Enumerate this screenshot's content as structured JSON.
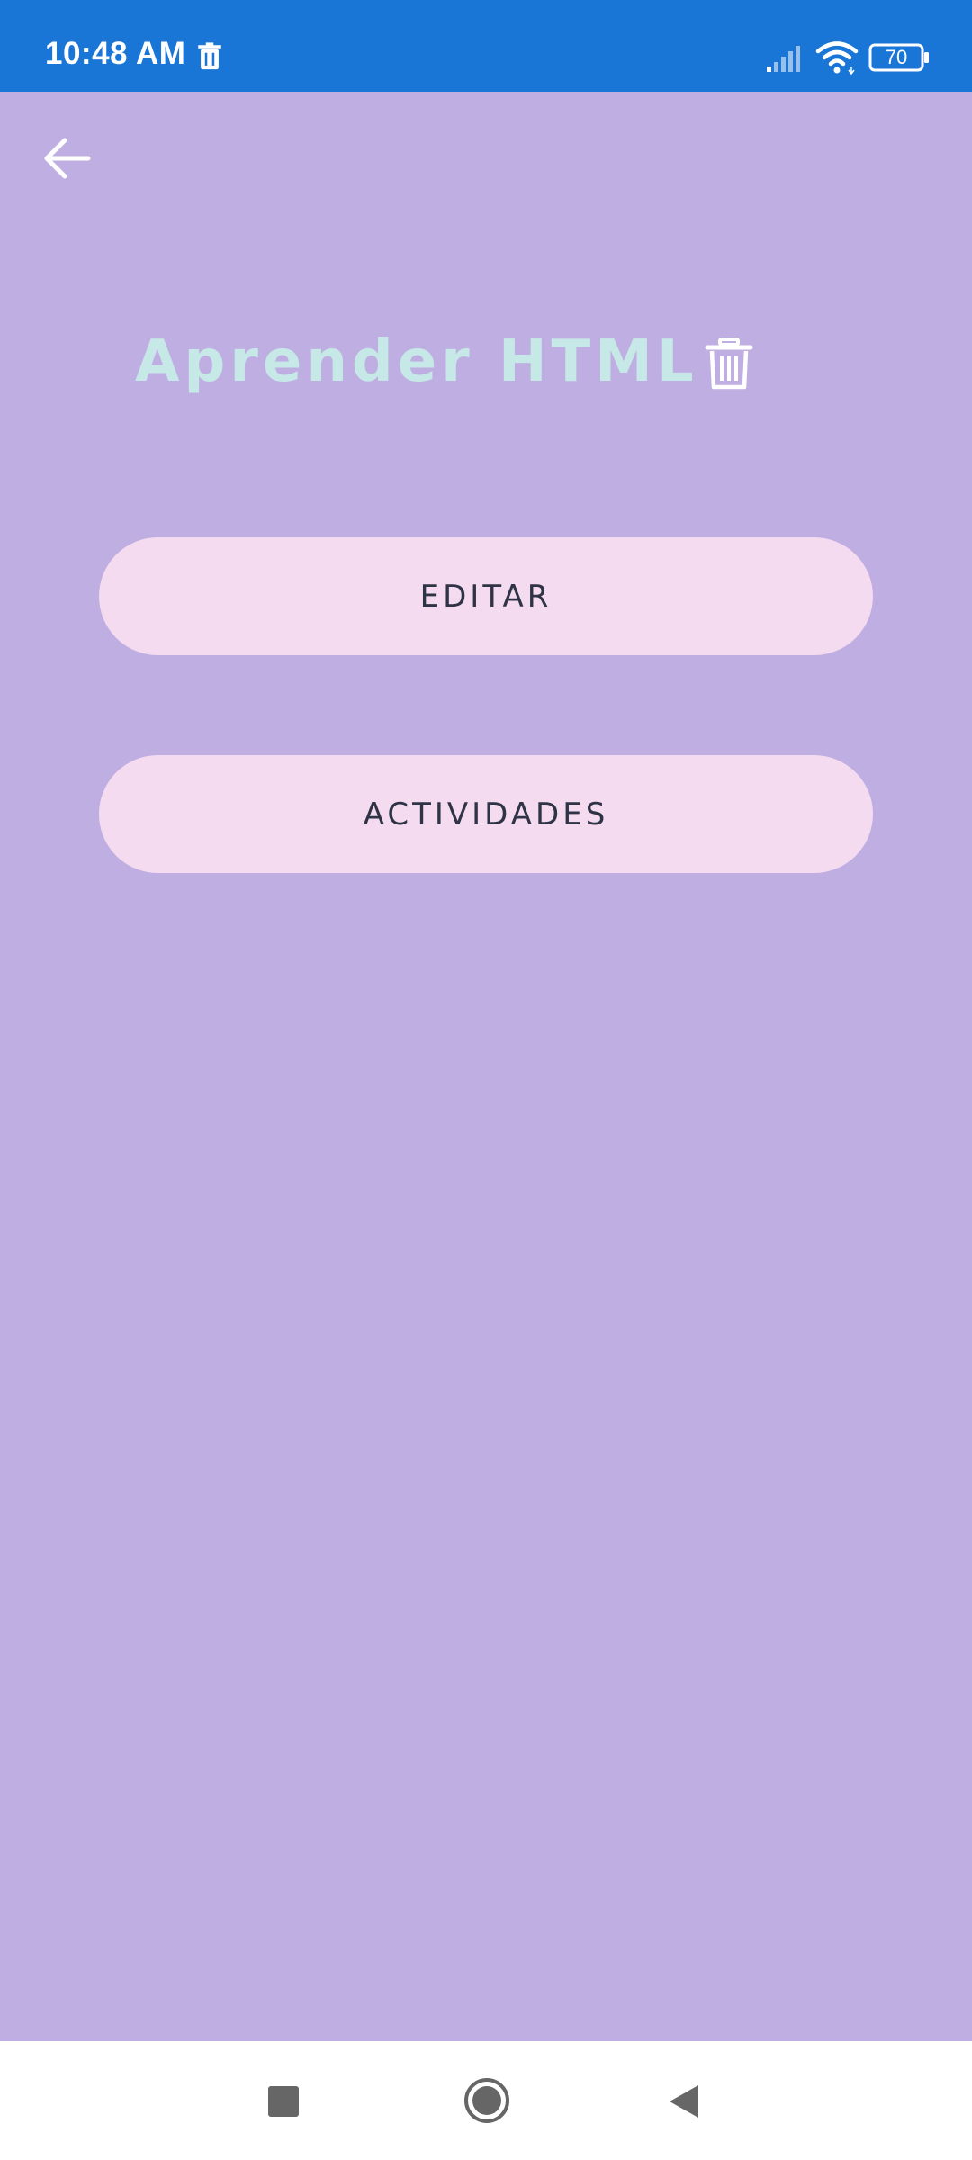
{
  "status_bar": {
    "time": "10:48 AM",
    "battery_level": "70",
    "icons": [
      "trash-icon",
      "signal-icon",
      "wifi-icon",
      "battery-icon"
    ],
    "background_color": "#1a76d6"
  },
  "header": {
    "back_icon": "arrow-left-icon"
  },
  "main": {
    "title": "Aprender HTML",
    "delete_icon": "trash-icon",
    "buttons": {
      "edit_label": "EDITAR",
      "activities_label": "ACTIVIDADES"
    }
  },
  "nav_bar": {
    "icons": [
      "recents-square-icon",
      "home-circle-icon",
      "back-triangle-icon"
    ]
  },
  "colors": {
    "background": "#bfaee2",
    "title": "#c6e8e6",
    "button_bg": "#f5dbf0",
    "button_text": "#2f3346"
  }
}
